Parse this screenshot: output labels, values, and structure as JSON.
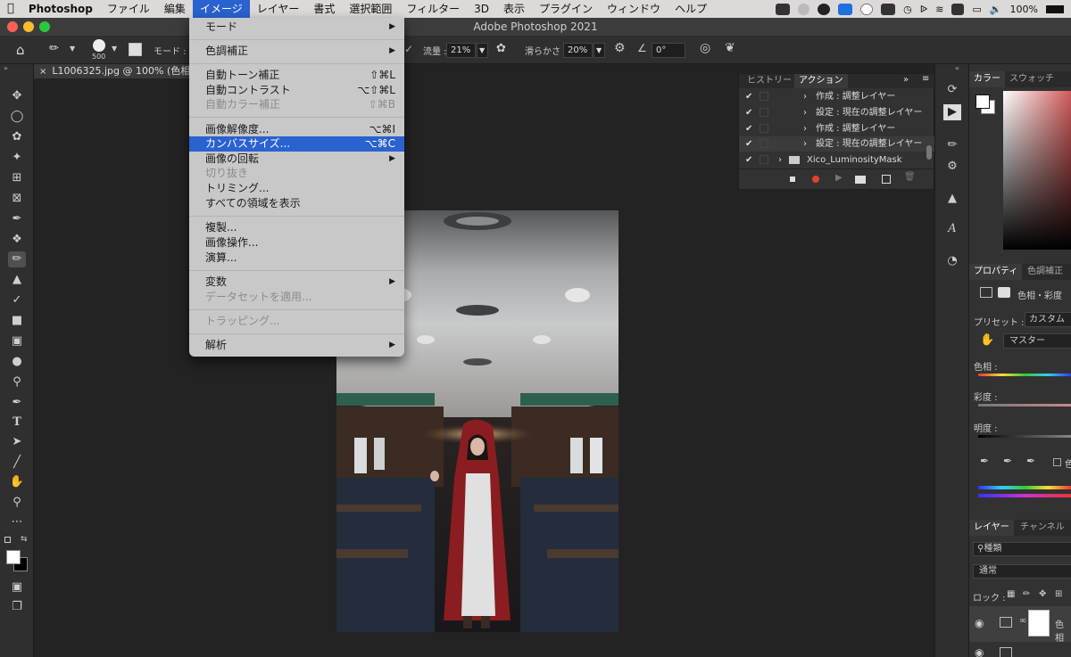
{
  "menubar": {
    "app": "Photoshop",
    "items": [
      "ファイル",
      "編集",
      "イメージ",
      "レイヤー",
      "書式",
      "選択範囲",
      "フィルター",
      "3D",
      "表示",
      "プラグイン",
      "ウィンドウ",
      "ヘルプ"
    ],
    "active": "イメージ",
    "battery": "100%"
  },
  "window": {
    "title": "Adobe Photoshop 2021"
  },
  "options": {
    "mode_label": "モード :",
    "brush_size": "500",
    "flow_label": "流量 :",
    "flow_value": "21%",
    "smoothing_label": "滑らかさ :",
    "smoothing_value": "20%",
    "angle_value": "0°"
  },
  "document": {
    "tab": "L1006325.jpg @ 100% (色相・"
  },
  "image_menu": {
    "mode": "モード",
    "adjustments": "色調補正",
    "auto_tone": "自動トーン補正",
    "auto_tone_sc": "⇧⌘L",
    "auto_contrast": "自動コントラスト",
    "auto_contrast_sc": "⌥⇧⌘L",
    "auto_color": "自動カラー補正",
    "auto_color_sc": "⇧⌘B",
    "image_size": "画像解像度...",
    "image_size_sc": "⌥⌘I",
    "canvas_size": "カンバスサイズ...",
    "canvas_size_sc": "⌥⌘C",
    "rotation": "画像の回転",
    "crop": "切り抜き",
    "trim": "トリミング...",
    "reveal_all": "すべての領域を表示",
    "duplicate": "複製...",
    "apply_image": "画像操作...",
    "calculations": "演算...",
    "variables": "変数",
    "apply_dataset": "データセットを適用...",
    "trapping": "トラッピング...",
    "analysis": "解析"
  },
  "actions_panel": {
    "tab_history": "ヒストリー",
    "tab_actions": "アクション",
    "rows": [
      "作成 : 調整レイヤー",
      "設定 : 現在の調整レイヤー",
      "作成 : 調整レイヤー",
      "設定 : 現在の調整レイヤー",
      "Xico_LuminosityMask"
    ]
  },
  "color_panel": {
    "tab_color": "カラー",
    "tab_swatches": "スウォッチ"
  },
  "properties_panel": {
    "tab_properties": "プロパティ",
    "tab_adjustments": "色調補正",
    "subtitle": "色相・彩度",
    "preset_label": "プリセット :",
    "preset_value": "カスタム",
    "channel_value": "マスター",
    "hue_label": "色相 :",
    "saturation_label": "彩度 :",
    "lightness_label": "明度 :",
    "colorize_label": "色"
  },
  "layers_panel": {
    "tab_layers": "レイヤー",
    "tab_channels": "チャンネル",
    "filter_value": "種類",
    "blend_mode": "通常",
    "lock_label": "ロック :",
    "layer_label": "色相"
  }
}
